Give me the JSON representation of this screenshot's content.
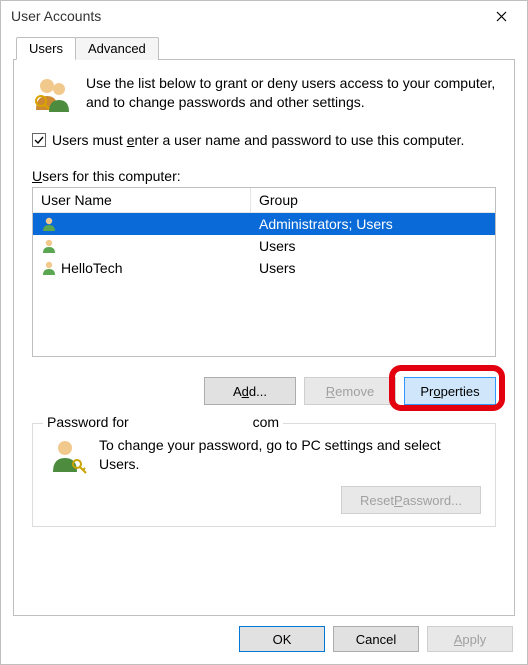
{
  "window": {
    "title": "User Accounts"
  },
  "tabs": {
    "users": "Users",
    "advanced": "Advanced",
    "active": "users"
  },
  "intro": "Use the list below to grant or deny users access to your computer, and to change passwords and other settings.",
  "require_login": {
    "checked": true,
    "label_pre": "Users must ",
    "label_ul": "e",
    "label_post": "nter a user name and password to use this computer."
  },
  "users_section": {
    "label_ul": "U",
    "label_rest": "sers for this computer:",
    "columns": {
      "name": "User Name",
      "group": "Group"
    },
    "rows": [
      {
        "name": "",
        "group": "Administrators; Users",
        "selected": true
      },
      {
        "name": "",
        "group": "Users",
        "selected": false
      },
      {
        "name": "HelloTech",
        "group": "Users",
        "selected": false
      }
    ]
  },
  "buttons": {
    "add_pre": "A",
    "add_ul": "d",
    "add_post": "d...",
    "remove_ul": "R",
    "remove_rest": "emove",
    "properties_pre": "Pr",
    "properties_ul": "o",
    "properties_post": "perties"
  },
  "password_box": {
    "legend_prefix": "Password for ",
    "legend_user": "",
    "legend_suffix": "com",
    "text": "To change your password, go to PC settings and select Users.",
    "reset_btn_pre": "Reset ",
    "reset_btn_ul": "P",
    "reset_btn_post": "assword..."
  },
  "bottom": {
    "ok": "OK",
    "cancel": "Cancel",
    "apply_ul": "A",
    "apply_rest": "pply"
  }
}
